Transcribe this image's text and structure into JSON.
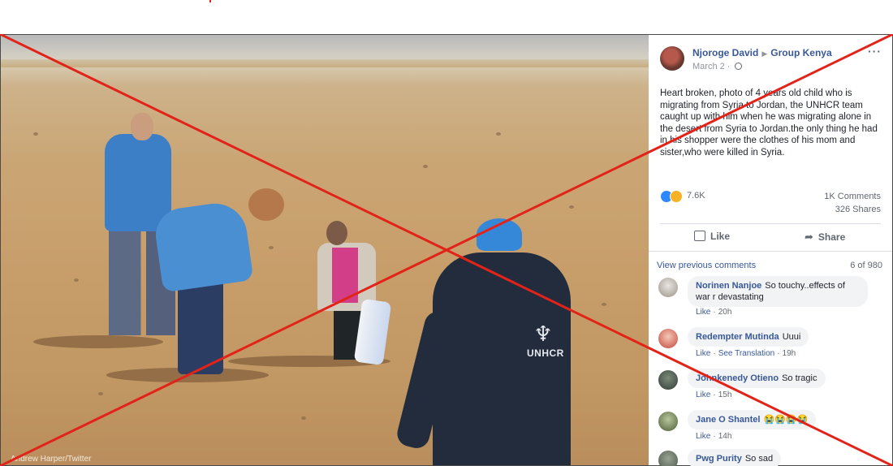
{
  "post": {
    "author": "Njoroge David",
    "group": "Group Kenya",
    "date": "March 2 · ",
    "text": "Heart broken, photo of 4 years old child who is migrating from Syria to Jordan, the UNHCR team caught up with him when he was migrating alone in the desert from Syria to Jordan.the only thing he had in his shopper were the clothes of his mom and sister,who were killed in Syria.",
    "reactions_count": "7.6K",
    "comments_count": "1K Comments",
    "shares_count": "326 Shares",
    "like_label": "Like",
    "share_label": "Share",
    "more_label": "···"
  },
  "photo": {
    "logo_text": "UNHCR",
    "credit": "Andrew Harper/Twitter"
  },
  "comments_section": {
    "view_previous": "View previous comments",
    "page_count": "6 of 980",
    "like_label": "Like",
    "see_translation": "See Translation",
    "items": [
      {
        "name": "Norinen Nanjoe",
        "text": "So touchy..effects of war r devastating",
        "time": "20h"
      },
      {
        "name": "Redempter Mutinda",
        "text": "Uuui",
        "time": "19h"
      },
      {
        "name": "Johnkenedy Otieno",
        "text": "So tragic",
        "time": "15h"
      },
      {
        "name": "Jane O Shantel",
        "text": "😭😭😭😭",
        "time": "14h"
      },
      {
        "name": "Pwg Purity",
        "text": "So sad",
        "time": ""
      }
    ]
  },
  "colors": {
    "link": "#385898",
    "cross": "#e2231a",
    "bubble": "#f2f3f5"
  },
  "icons": [
    "options-icon",
    "globe-icon",
    "like-reaction-icon",
    "sad-reaction-icon",
    "thumbs-up-icon",
    "share-arrow-icon"
  ]
}
